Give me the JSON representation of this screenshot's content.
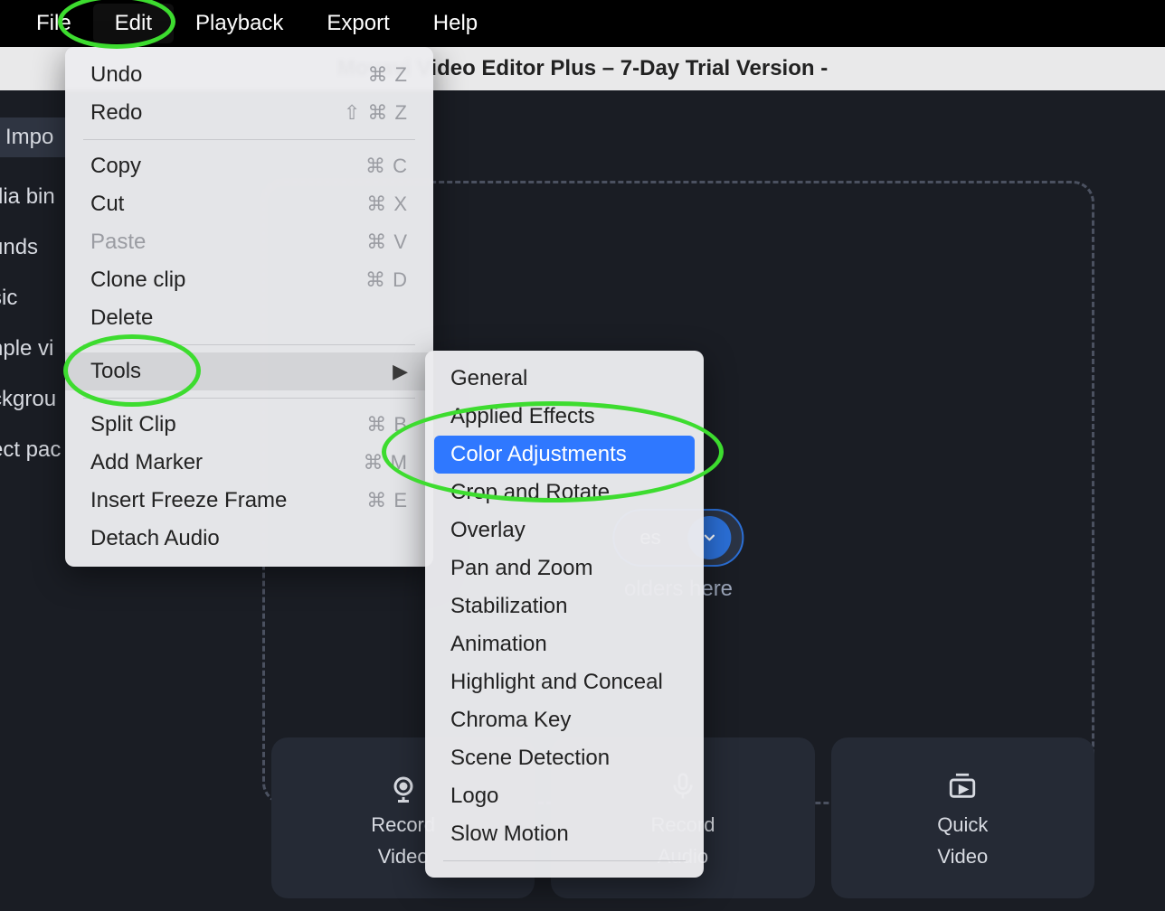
{
  "menubar": {
    "items": [
      "File",
      "Edit",
      "Playback",
      "Export",
      "Help"
    ],
    "active_index": 1
  },
  "title_bar": {
    "title": "Movavi Video Editor Plus – 7-Day Trial Version -"
  },
  "sidebar": {
    "tab_label": "Impo",
    "items": [
      "dia bin",
      "unds",
      "sic",
      "nple vi",
      "ckgrou",
      "ect pac"
    ]
  },
  "dropzone": {
    "add_files_label": "es",
    "hint_text": "olders here"
  },
  "actions": [
    {
      "icon": "camera",
      "line1": "Record",
      "line2": "Video"
    },
    {
      "icon": "mic",
      "line1": "Record",
      "line2": "Audio"
    },
    {
      "icon": "quick",
      "line1": "Quick",
      "line2": "Video"
    }
  ],
  "edit_menu": {
    "groups": [
      [
        {
          "label": "Undo",
          "shortcut": "⌘ Z"
        },
        {
          "label": "Redo",
          "shortcut": "⇧ ⌘ Z"
        }
      ],
      [
        {
          "label": "Copy",
          "shortcut": "⌘ C"
        },
        {
          "label": "Cut",
          "shortcut": "⌘ X"
        },
        {
          "label": "Paste",
          "shortcut": "⌘ V",
          "disabled": true
        },
        {
          "label": "Clone clip",
          "shortcut": "⌘ D"
        },
        {
          "label": "Delete",
          "shortcut": ""
        }
      ],
      [
        {
          "label": "Tools",
          "submenu": true
        }
      ],
      [
        {
          "label": "Split Clip",
          "shortcut": "⌘ B"
        },
        {
          "label": "Add Marker",
          "shortcut": "⌘ M"
        },
        {
          "label": "Insert Freeze Frame",
          "shortcut": "⌘ E"
        },
        {
          "label": "Detach Audio",
          "shortcut": ""
        }
      ]
    ]
  },
  "tools_menu": {
    "items_top": [
      "General",
      "Applied Effects",
      "Color Adjustments",
      "Crop and Rotate",
      "Overlay",
      "Pan and Zoom",
      "Stabilization",
      "Animation",
      "Highlight and Conceal",
      "Chroma Key",
      "Scene Detection",
      "Logo",
      "Slow Motion"
    ],
    "highlighted_index": 2
  }
}
